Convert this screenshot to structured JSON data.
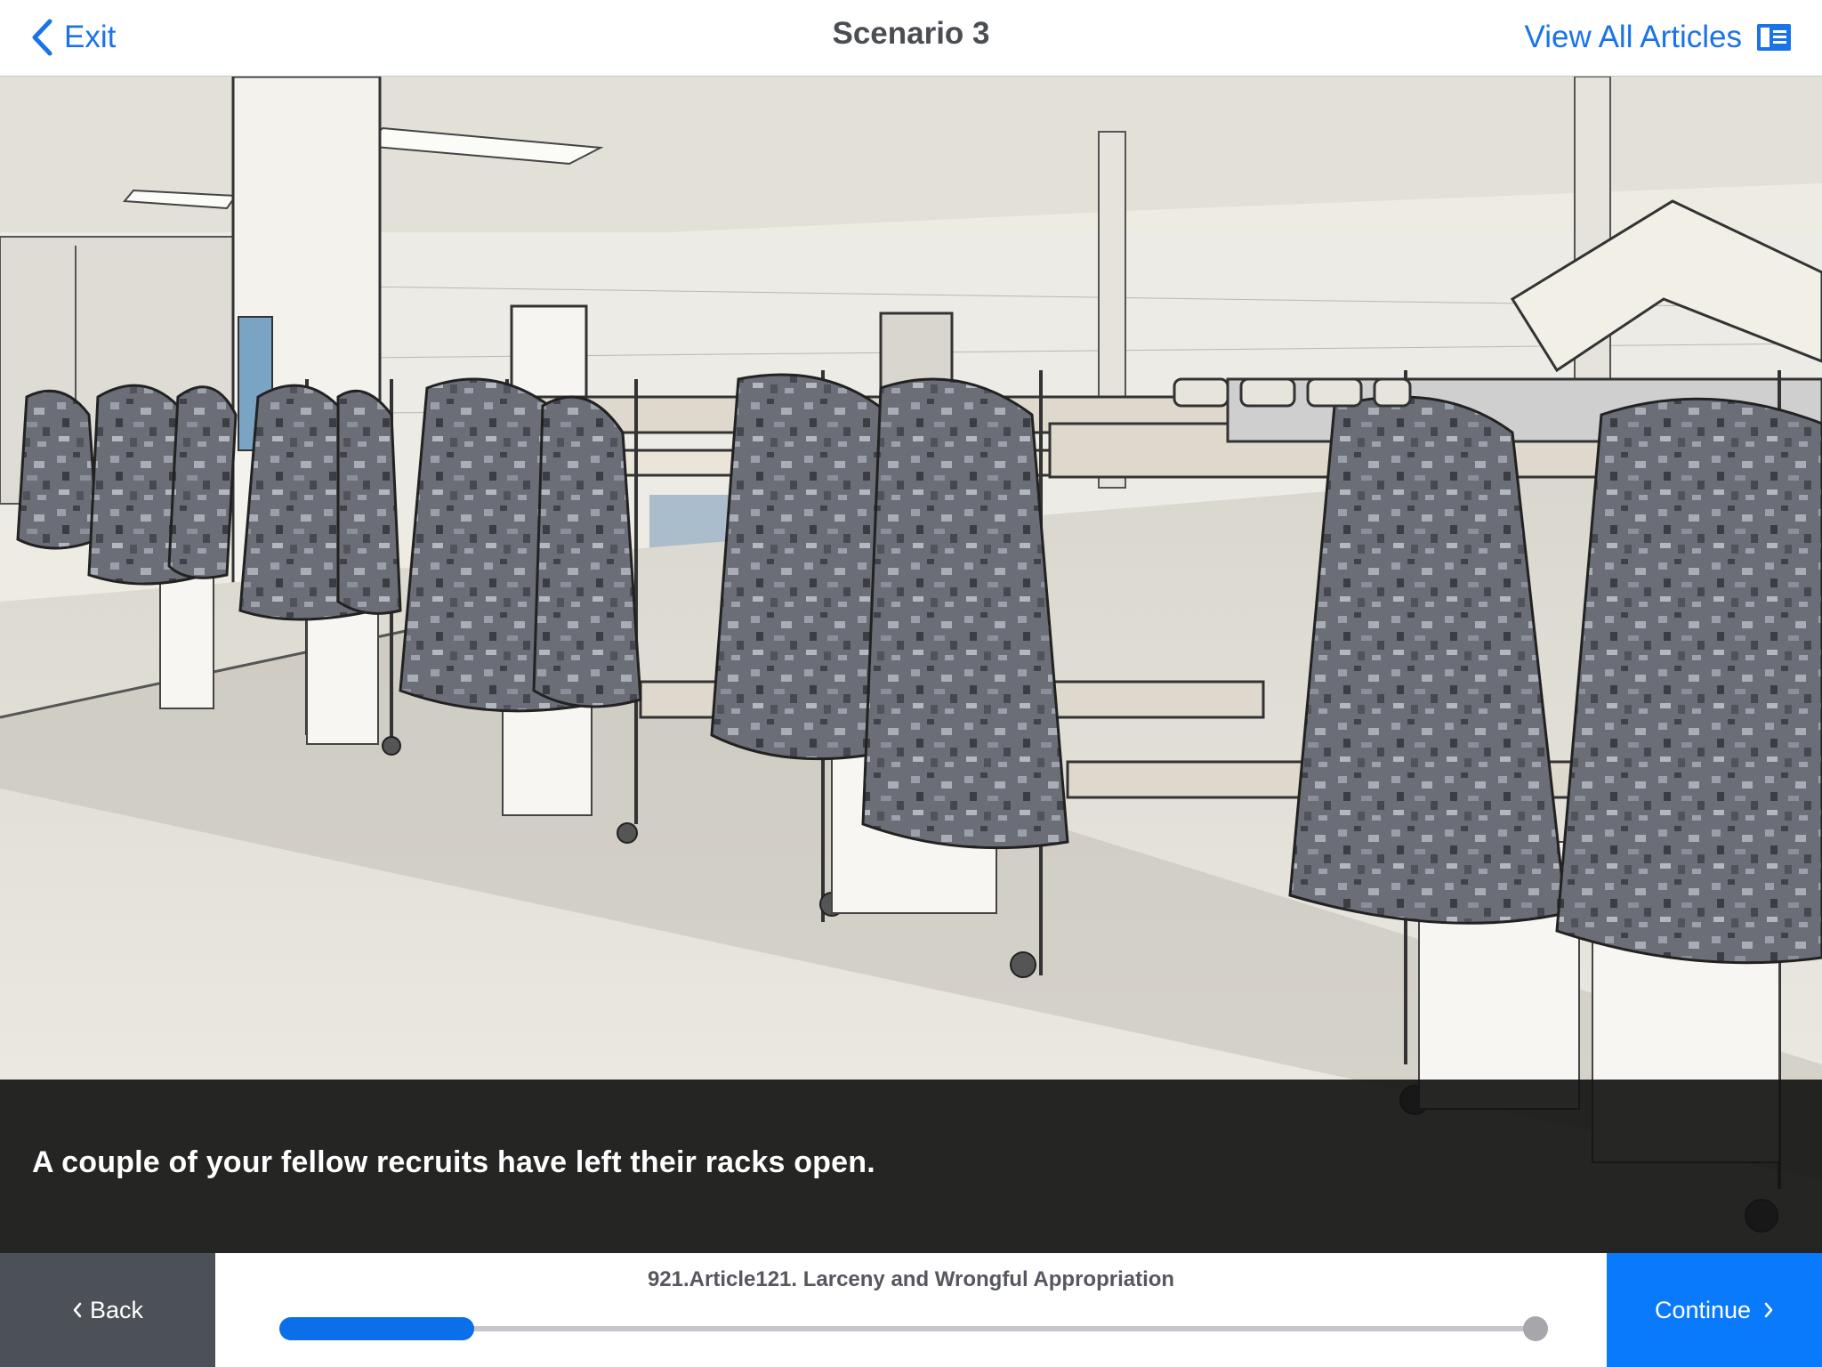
{
  "header": {
    "exit_label": "Exit",
    "title": "Scenario 3",
    "view_all_label": "View All Articles"
  },
  "scene": {
    "caption": "A couple of your fellow recruits have left their racks open."
  },
  "footer": {
    "back_label": "Back",
    "continue_label": "Continue",
    "chapter_title": "921.Article121. Larceny and Wrongful Appropriation",
    "progress": 0.155
  },
  "icons": {
    "exit": "chevron-left-icon",
    "articles": "book-icon",
    "back": "chevron-left-small-icon",
    "continue": "chevron-right-small-icon"
  },
  "colors": {
    "accent": "#0a7afc",
    "back_bg": "#4c5157",
    "caption_bg": "#141414"
  }
}
